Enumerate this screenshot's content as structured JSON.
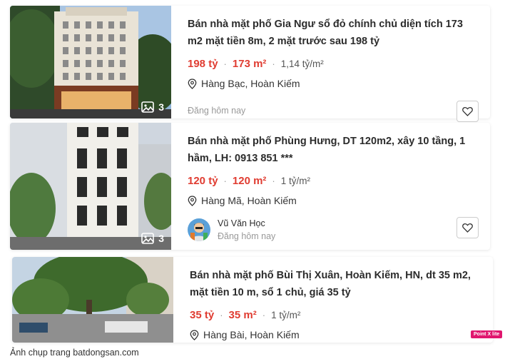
{
  "listings": [
    {
      "title": "Bán nhà mặt phố Gia Ngư sổ đỏ chính chủ diện tích 173 m2 mặt tiền 8m, 2 mặt trước sau 198 tỷ",
      "price": "198 tỷ",
      "area": "173 m²",
      "price_per_m2": "1,14 tỷ/m²",
      "location": "Hàng Bạc, Hoàn Kiếm",
      "posted": "Đăng hôm nay",
      "photo_count": "3"
    },
    {
      "title": "Bán nhà mặt phố Phùng Hưng, DT 120m2, xây 10 tầng, 1 hầm, LH: 0913 851 ***",
      "price": "120 tỷ",
      "area": "120 m²",
      "price_per_m2": "1 tỷ/m²",
      "location": "Hàng Mã, Hoàn Kiếm",
      "agent_name": "Vũ Văn Học",
      "posted": "Đăng hôm nay",
      "photo_count": "3"
    },
    {
      "title": "Bán nhà mặt phố Bùi Thị Xuân, Hoàn Kiếm, HN, dt 35 m2, mặt tiền 10 m, sổ 1 chủ, giá 35 tỷ",
      "price": "35 tỷ",
      "area": "35 m²",
      "price_per_m2": "1 tỷ/m²",
      "location": "Hàng Bài, Hoàn Kiếm"
    }
  ],
  "badge": "Point X lite",
  "caption": "Ảnh chụp trang batdongsan.com",
  "colors": {
    "price": "#e03c31",
    "badge": "#e0166e"
  },
  "icons": {
    "location": "location-pin-icon",
    "favorite": "heart-icon",
    "photos": "image-icon"
  }
}
